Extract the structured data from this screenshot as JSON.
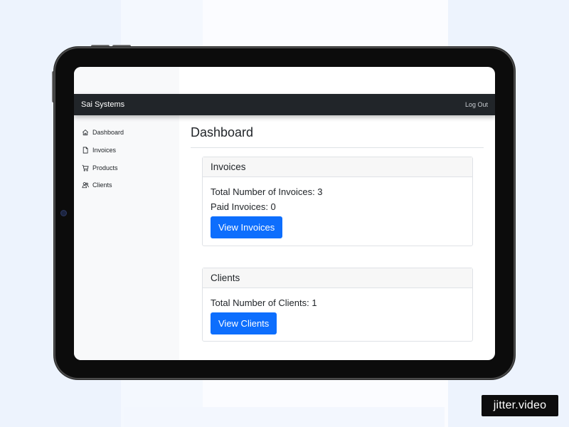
{
  "navbar": {
    "brand": "Sai Systems",
    "logout_label": "Log Out"
  },
  "sidebar": {
    "items": [
      {
        "label": "Dashboard",
        "icon": "home-icon"
      },
      {
        "label": "Invoices",
        "icon": "file-icon"
      },
      {
        "label": "Products",
        "icon": "cart-icon"
      },
      {
        "label": "Clients",
        "icon": "people-icon"
      }
    ]
  },
  "main": {
    "title": "Dashboard",
    "invoices_card": {
      "header": "Invoices",
      "total_label": "Total Number of Invoices: 3",
      "paid_label": "Paid Invoices: 0",
      "button_label": "View Invoices"
    },
    "clients_card": {
      "header": "Clients",
      "total_label": "Total Number of Clients: 1",
      "button_label": "View Clients"
    }
  },
  "colors": {
    "navbar_bg": "#212529",
    "primary_button": "#0d6efd",
    "page_bg": "#edf3fd"
  },
  "watermark": "jitter.video"
}
